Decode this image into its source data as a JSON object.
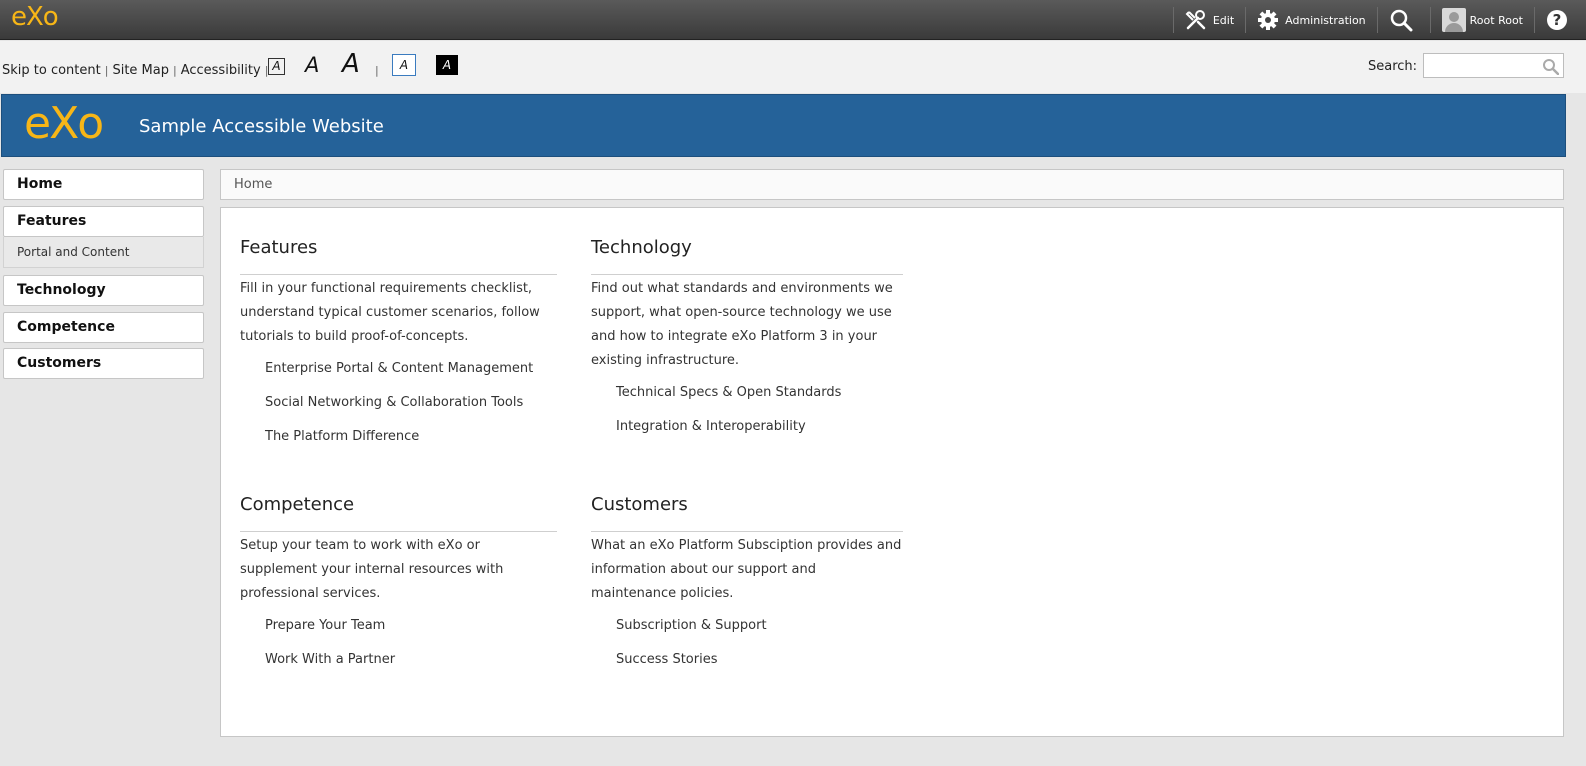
{
  "topbar": {
    "logo": "eXo",
    "edit_label": "Edit",
    "admin_label": "Administration",
    "user_label": "Root Root",
    "icons": [
      "edit-icon",
      "gear-icon",
      "search-icon",
      "avatar",
      "help-icon"
    ]
  },
  "accessibility": {
    "skip": "Skip to content",
    "sitemap": "Site Map",
    "accessibility": "Accessibility",
    "font_small": "A",
    "font_medium": "A",
    "font_large": "A",
    "contrast_normal": "A",
    "contrast_high": "A",
    "search_label": "Search:",
    "search_value": ""
  },
  "banner": {
    "logo": "eXo",
    "title": "Sample Accessible Website"
  },
  "nav": {
    "items": [
      {
        "label": "Home"
      },
      {
        "label": "Features"
      },
      {
        "label": "Technology"
      },
      {
        "label": "Competence"
      },
      {
        "label": "Customers"
      }
    ],
    "sub_item": "Portal and Content"
  },
  "breadcrumb": "Home",
  "sections": [
    {
      "title": "Features",
      "text": "Fill in your functional requirements checklist, understand typical customer scenarios, follow tutorials to build proof-of-concepts.",
      "links": [
        "Enterprise Portal & Content Management",
        "Social Networking & Collaboration Tools",
        "The Platform Difference"
      ]
    },
    {
      "title": "Technology",
      "text": "Find out what standards and environments we support, what open-source technology we use and how to integrate eXo Platform 3 in your existing infrastructure.",
      "links": [
        "Technical Specs & Open Standards",
        "Integration & Interoperability"
      ]
    },
    {
      "title": "Competence",
      "text": "Setup your team to work with eXo or supplement your internal resources with professional services.",
      "links": [
        "Prepare Your Team",
        "Work With a Partner"
      ]
    },
    {
      "title": "Customers",
      "text": "What an eXo Platform Subsciption provides and information about our support and maintenance policies.",
      "links": [
        "Subscription & Support",
        "Success Stories"
      ]
    }
  ],
  "colors": {
    "brand_yellow": "#f7b617",
    "banner_blue": "#256299",
    "topbar_dark": "#454545"
  }
}
